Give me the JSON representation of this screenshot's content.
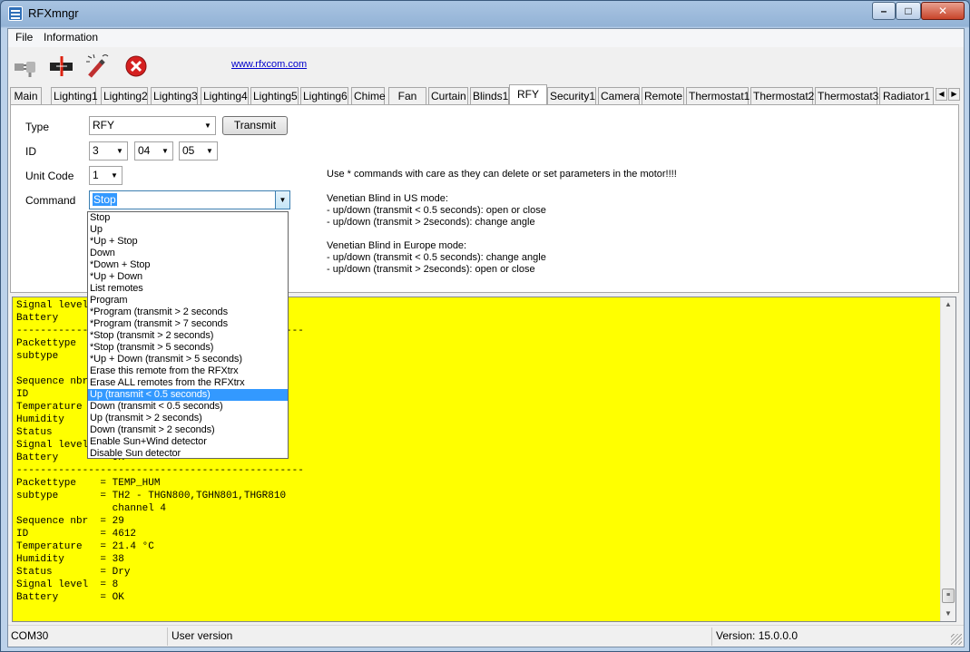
{
  "window": {
    "title": "RFXmngr",
    "controls": {
      "min": "–",
      "max": "□",
      "close": "✕"
    }
  },
  "menu": [
    "File",
    "Information"
  ],
  "toolbar": {
    "icons": [
      "plug-disconnect-icon",
      "plug-connect-icon",
      "wand-icon",
      "stop-icon"
    ],
    "link": "www.rfxcom.com"
  },
  "tabs": [
    "Main",
    "Lighting1",
    "Lighting2",
    "Lighting3",
    "Lighting4",
    "Lighting5",
    "Lighting6",
    "Chime",
    "Fan",
    "Curtain",
    "Blinds1",
    "RFY",
    "Security1",
    "Camera",
    "Remote",
    "Thermostat1",
    "Thermostat2",
    "Thermostat3",
    "Radiator1"
  ],
  "active_tab": "RFY",
  "form": {
    "type_label": "Type",
    "type_value": "RFY",
    "transmit_label": "Transmit",
    "id_label": "ID",
    "id_values": [
      "3",
      "04",
      "05"
    ],
    "unit_label": "Unit Code",
    "unit_value": "1",
    "command_label": "Command",
    "command_value": "Stop"
  },
  "notes": [
    "Use * commands with care as they can delete or set parameters in the motor!!!!",
    "Venetian Blind in US mode:\n- up/down (transmit < 0.5 seconds): open or close\n- up/down (transmit > 2seconds): change angle",
    "Venetian Blind in Europe mode:\n- up/down (transmit < 0.5 seconds): change angle\n- up/down (transmit > 2seconds): open or close"
  ],
  "command_options": [
    "Stop",
    "Up",
    "*Up + Stop",
    "Down",
    "*Down + Stop",
    "*Up + Down",
    "List remotes",
    "Program",
    "*Program (transmit > 2 seconds",
    "*Program (transmit > 7 seconds",
    "*Stop (transmit > 2 seconds)",
    "*Stop (transmit > 5 seconds)",
    "*Up + Down (transmit > 5 seconds)",
    "Erase this remote from the RFXtrx",
    "Erase ALL remotes from the RFXtrx",
    "Up (transmit < 0.5 seconds)",
    "Down (transmit < 0.5 seconds)",
    "Up (transmit > 2 seconds)",
    "Down (transmit > 2 seconds)",
    "Enable Sun+Wind detector",
    "Disable Sun detector"
  ],
  "highlighted_option": "Up (transmit < 0.5 seconds)",
  "log_lines": [
    "Signal level  = 8",
    "Battery       = OK",
    "------------------------------------------------",
    "Packettype    = TEMP_HUM",
    "subtype       = TH2 - THGN800,TGHN801,THGR810",
    "",
    "Sequence nbr  = 28",
    "ID            = 4612",
    "Temperature   = 21.4 °C",
    "Humidity      = 38",
    "Status        = Dry",
    "Signal level  = 8",
    "Battery       = OK",
    "------------------------------------------------",
    "Packettype    = TEMP_HUM",
    "subtype       = TH2 - THGN800,TGHN801,THGR810",
    "                channel 4",
    "Sequence nbr  = 29",
    "ID            = 4612",
    "Temperature   = 21.4 °C",
    "Humidity      = 38",
    "Status        = Dry",
    "Signal level  = 8",
    "Battery       = OK"
  ],
  "status": {
    "port": "COM30",
    "user": "User version",
    "version": "Version: 15.0.0.0"
  }
}
